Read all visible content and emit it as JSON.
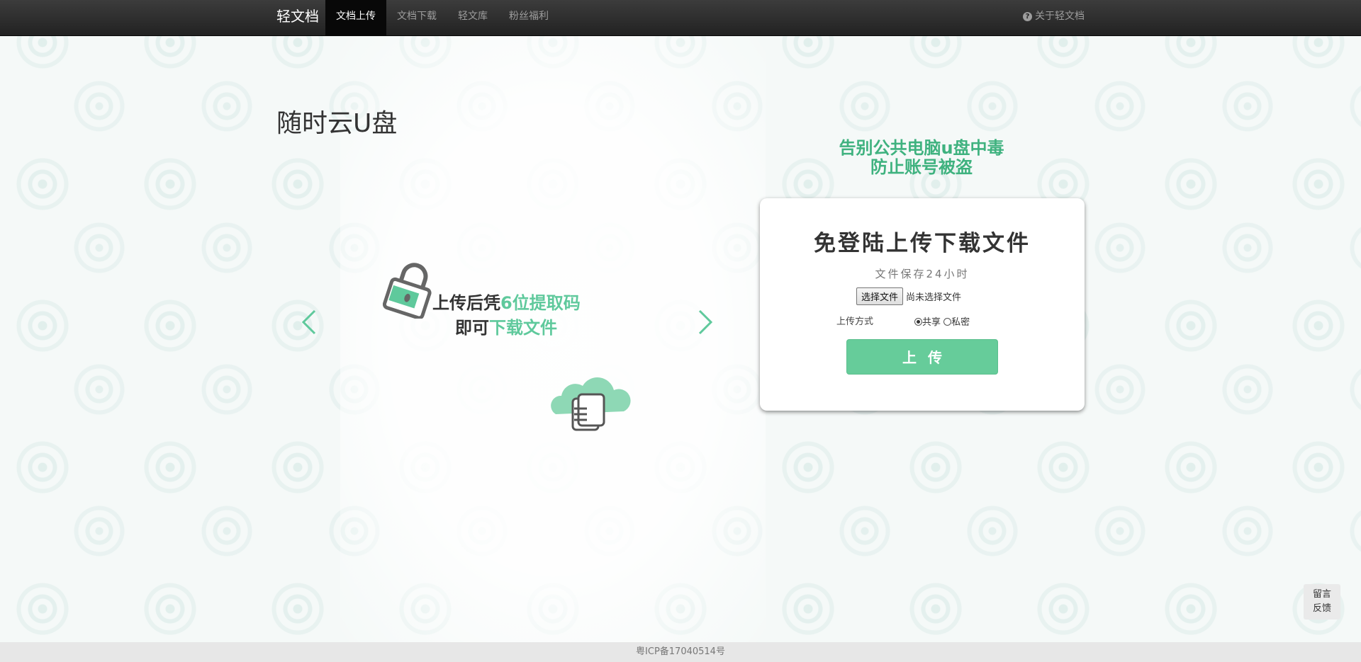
{
  "nav": {
    "brand": "轻文档",
    "items": [
      {
        "label": "文档上传"
      },
      {
        "label": "文档下载"
      },
      {
        "label": "轻文库"
      },
      {
        "label": "粉丝福利"
      }
    ],
    "about": "关于轻文档",
    "about_icon": "question-circle-icon"
  },
  "page_title": "随时云U盘",
  "carousel": {
    "line1_a": "上传后凭",
    "line1_b": "6位提取码",
    "line2_a": "即可",
    "line2_b": "下载文件"
  },
  "slogan": {
    "line1": "告别公共电脑u盘中毒",
    "line2": "防止账号被盗"
  },
  "card": {
    "title": "免登陆上传下载文件",
    "subtitle": "文件保存24小时",
    "file_button": "选择文件",
    "file_status": "尚未选择文件",
    "mode_label": "上传方式",
    "option_share": "共享",
    "option_private": "私密",
    "selected_option": "共享",
    "upload_button": "上传"
  },
  "feedback": {
    "line1": "留言",
    "line2": "反馈"
  },
  "footer": "粤ICP备17040514号",
  "colors": {
    "accent": "#5fc99c",
    "slogan": "#3fb27f",
    "button": "#66cc9a",
    "navbar": "#222222"
  }
}
